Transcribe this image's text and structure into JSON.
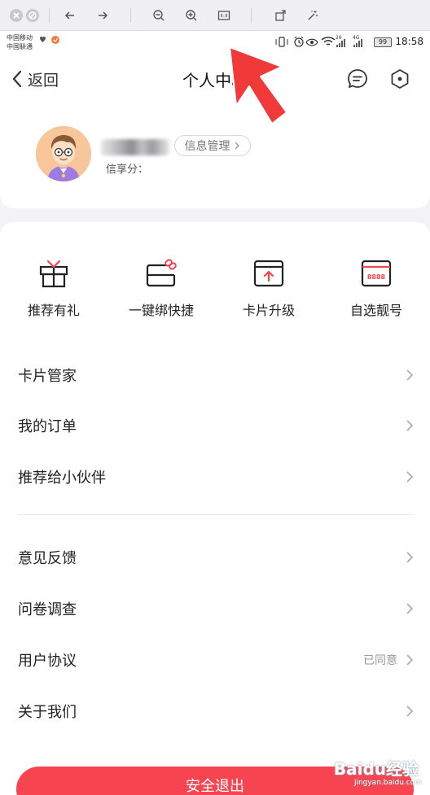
{
  "status_bar": {
    "carrier1": "中国移动",
    "carrier2": "中国联通",
    "signal_tag1": "26",
    "signal_tag2": "4G",
    "battery": "99",
    "time": "18:58"
  },
  "nav": {
    "back_label": "返回",
    "title": "个人中心"
  },
  "profile": {
    "info_button": "信息管理",
    "points_label": "信享分："
  },
  "features": [
    {
      "label": "推荐有礼",
      "icon": "gift-icon"
    },
    {
      "label": "一键绑快捷",
      "icon": "card-link-icon"
    },
    {
      "label": "卡片升级",
      "icon": "card-upgrade-icon"
    },
    {
      "label": "自选靓号",
      "icon": "card-number-icon",
      "number": "8888"
    }
  ],
  "menu_group1": [
    {
      "label": "卡片管家"
    },
    {
      "label": "我的订单"
    },
    {
      "label": "推荐给小伙伴"
    }
  ],
  "menu_group2": [
    {
      "label": "意见反馈",
      "status": ""
    },
    {
      "label": "问卷调查",
      "status": ""
    },
    {
      "label": "用户协议",
      "status": "已同意"
    },
    {
      "label": "关于我们",
      "status": ""
    }
  ],
  "logout_label": "安全退出",
  "watermark": {
    "logo": "Baidu经验",
    "url": "jingyan.baidu.com"
  },
  "colors": {
    "accent": "#f64550",
    "arrow": "#f03a3a"
  }
}
